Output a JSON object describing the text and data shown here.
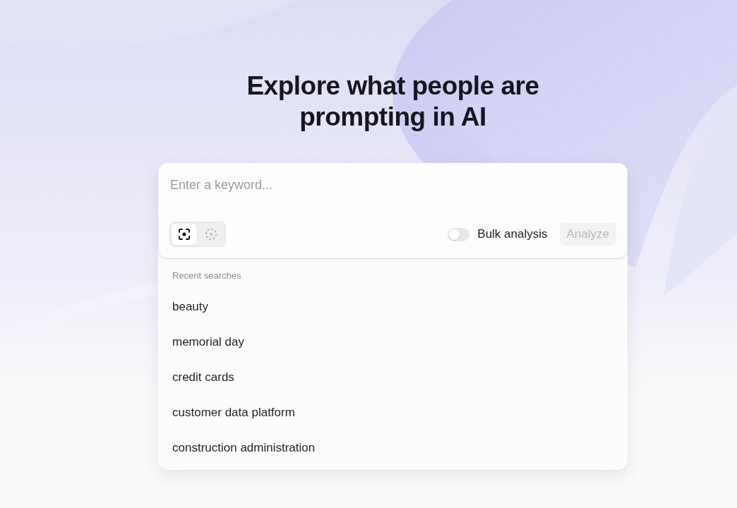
{
  "heading": "Explore what people are prompting in AI",
  "search": {
    "placeholder": "Enter a keyword..."
  },
  "modes": [
    {
      "selected": true
    },
    {
      "selected": false
    }
  ],
  "bulk_analysis": {
    "label": "Bulk analysis",
    "on": false
  },
  "analyze_button": {
    "label": "Analyze",
    "disabled": true
  },
  "recent_searches": {
    "title": "Recent searches",
    "items": [
      "beauty",
      "memorial day",
      "credit cards",
      "customer data platform",
      "construction administration"
    ]
  }
}
